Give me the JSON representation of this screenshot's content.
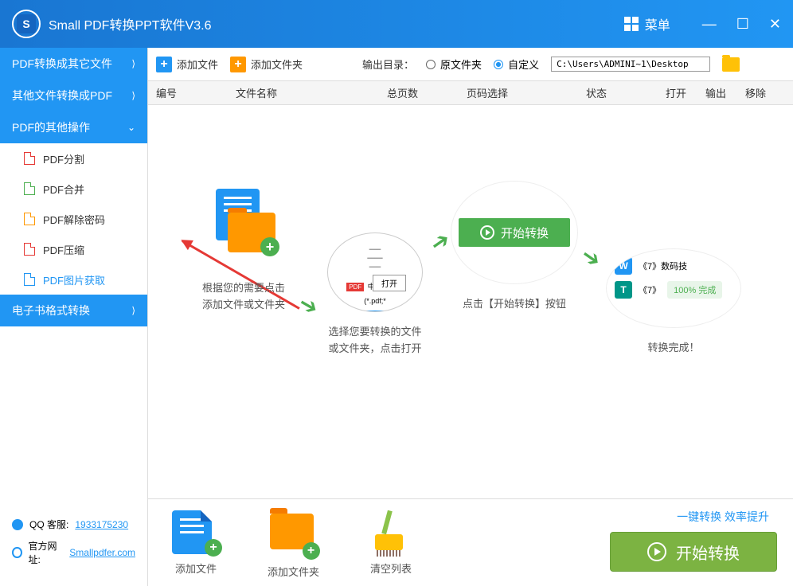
{
  "titlebar": {
    "app_title": "Small  PDF转换PPT软件V3.6",
    "menu_label": "菜单"
  },
  "sidebar": {
    "groups": [
      {
        "label": "PDF转换成其它文件",
        "expanded": false
      },
      {
        "label": "其他文件转换成PDF",
        "expanded": false
      },
      {
        "label": "PDF的其他操作",
        "expanded": true
      },
      {
        "label": "电子书格式转换",
        "expanded": false
      }
    ],
    "pdf_ops": [
      {
        "label": "PDF分割",
        "icon": "red"
      },
      {
        "label": "PDF合并",
        "icon": "green"
      },
      {
        "label": "PDF解除密码",
        "icon": "orange"
      },
      {
        "label": "PDF压缩",
        "icon": "red"
      },
      {
        "label": "PDF图片获取",
        "icon": "blue",
        "active": true
      }
    ],
    "qq_label": "QQ 客服:",
    "qq_number": "1933175230",
    "site_label": "官方网址:",
    "site_url": "Smallpdfer.com"
  },
  "toolbar": {
    "add_file": "添加文件",
    "add_folder": "添加文件夹",
    "output_label": "输出目录：",
    "radio_original": "原文件夹",
    "radio_custom": "自定义",
    "path": "C:\\Users\\ADMINI~1\\Desktop"
  },
  "table": {
    "col_num": "编号",
    "col_name": "文件名称",
    "col_pages": "总页数",
    "col_range": "页码选择",
    "col_status": "状态",
    "col_open": "打开",
    "col_output": "输出",
    "col_remove": "移除"
  },
  "steps": {
    "step1_line1": "根据您的需要点击",
    "step1_line2": "添加文件或文件夹",
    "step2_line1": "选择您要转换的文件",
    "step2_line2": "或文件夹，点击打开",
    "step2_pdf_text": "中外著名疑(*.pdf;*",
    "step2_open": "打开",
    "step3_btn": "开始转换",
    "step3_text": "点击【开始转换】按钮",
    "step4_file1": "《7》数码技",
    "step4_file2": "《7》",
    "step4_progress": "100%  完成",
    "step4_text": "转换完成！"
  },
  "bottom": {
    "add_file": "添加文件",
    "add_folder": "添加文件夹",
    "clear_list": "清空列表",
    "tagline": "一键转换  效率提升",
    "start_convert": "开始转换"
  }
}
